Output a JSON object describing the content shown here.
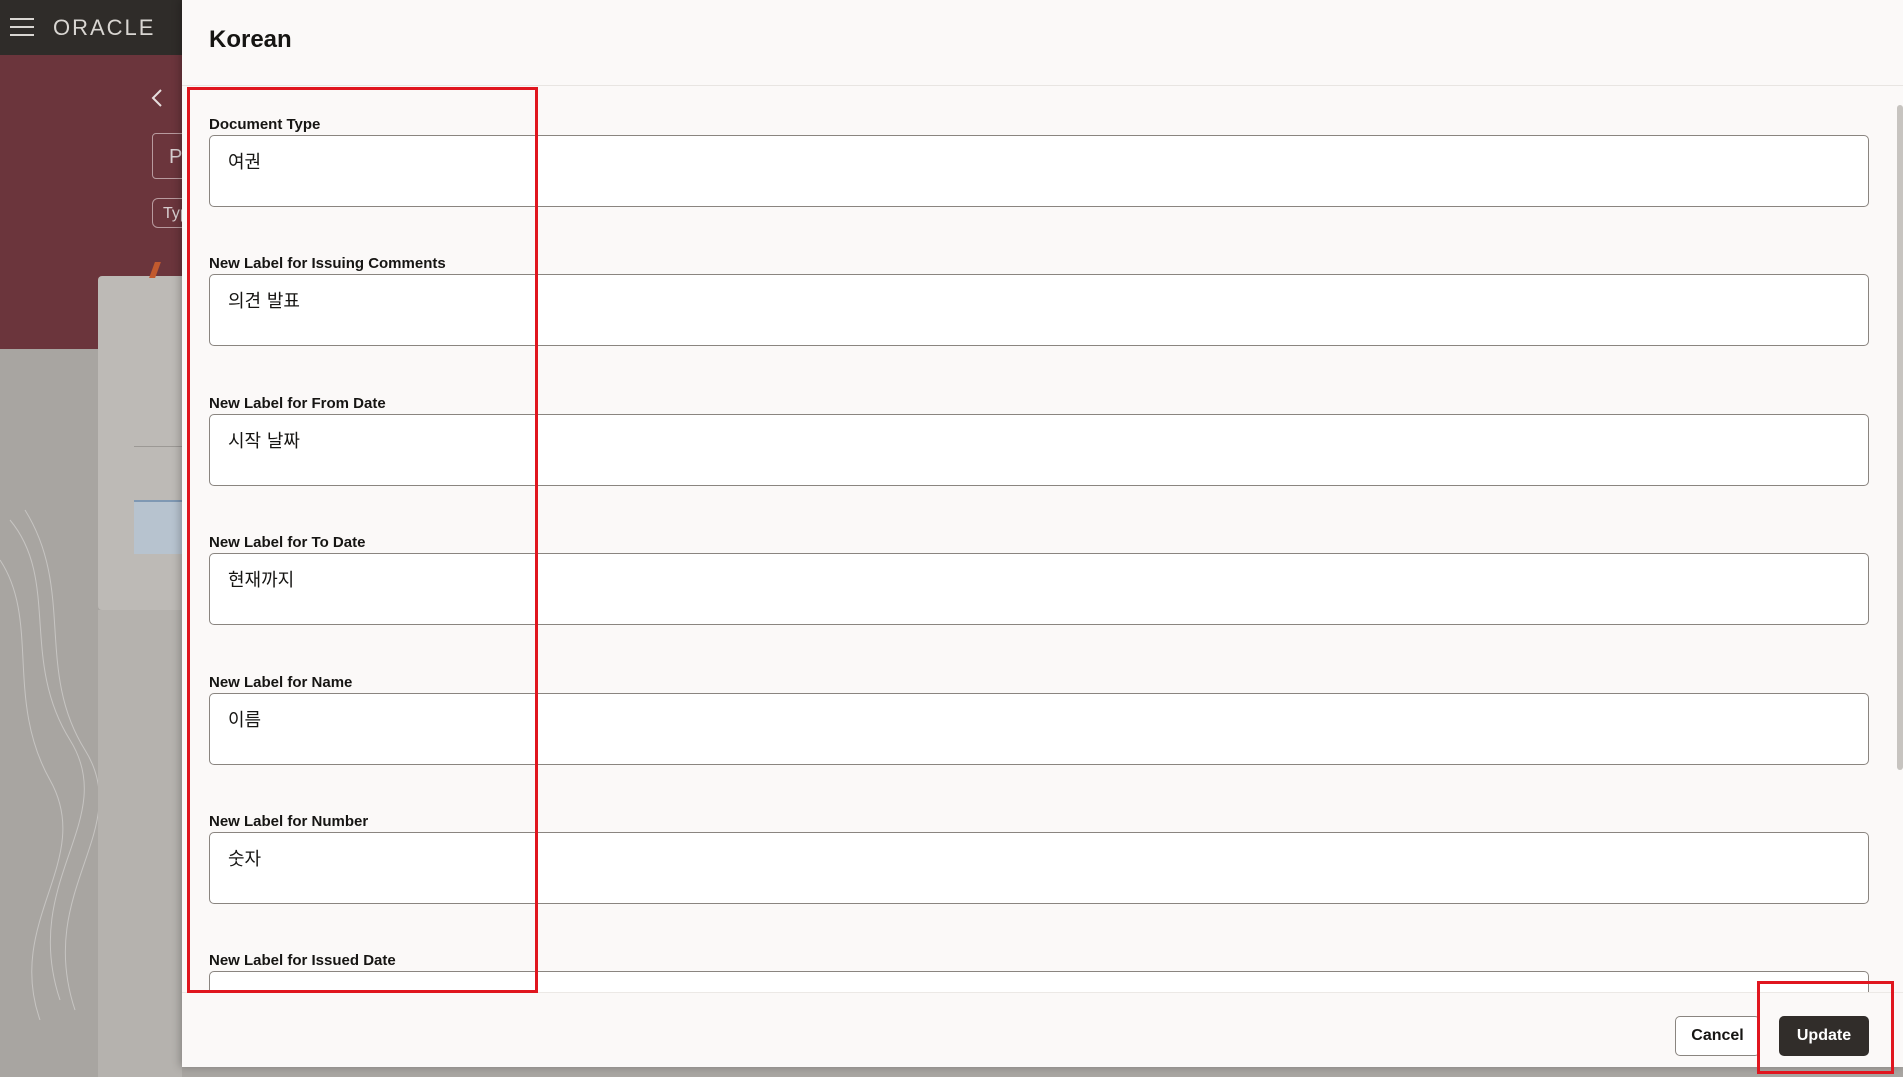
{
  "background_app": {
    "logo_text": "ORACLE",
    "ghost_input_text": "P",
    "ghost_chip_text": "Typ"
  },
  "drawer": {
    "title": "Korean",
    "fields": [
      {
        "label": "Document Type",
        "value": "여권"
      },
      {
        "label": "New Label for Issuing Comments",
        "value": "의견 발표"
      },
      {
        "label": "New Label for From Date",
        "value": "시작 날짜"
      },
      {
        "label": "New Label for To Date",
        "value": "현재까지"
      },
      {
        "label": "New Label for Name",
        "value": "이름"
      },
      {
        "label": "New Label for Number",
        "value": "숫자"
      },
      {
        "label": "New Label for Issued Date",
        "value": ""
      }
    ],
    "footer": {
      "cancel_label": "Cancel",
      "update_label": "Update"
    }
  },
  "colors": {
    "header_bar": "#2f2c29",
    "hero": "#6b353c",
    "primary_button": "#312d2a",
    "highlight": "#e0161f"
  }
}
